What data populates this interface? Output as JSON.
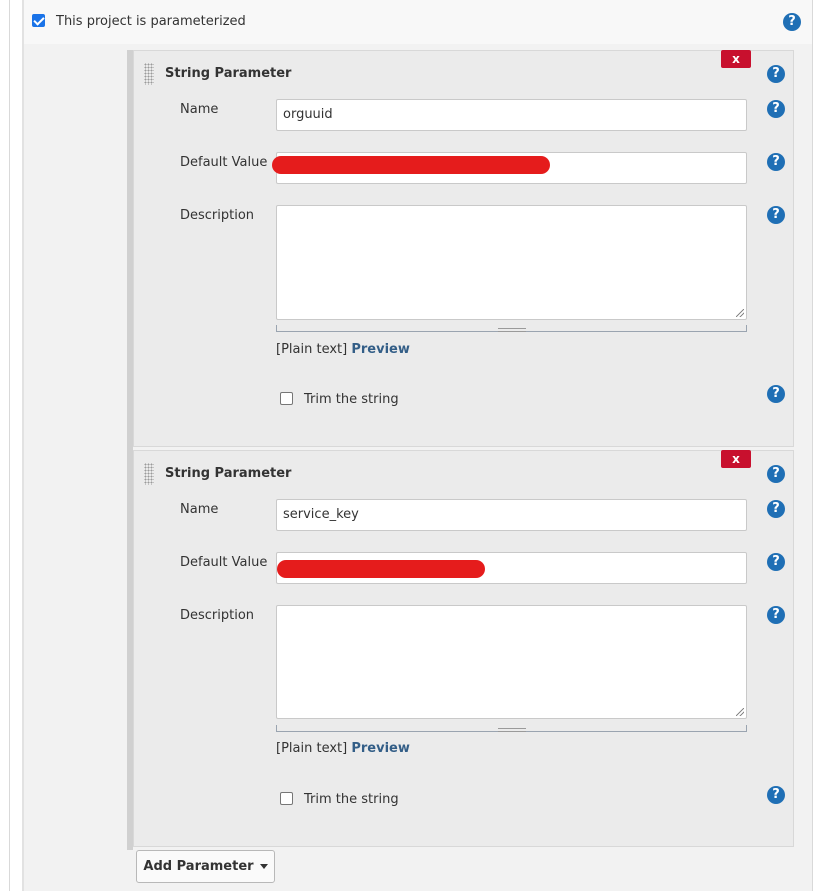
{
  "project": {
    "parameterized_label": "This project is parameterized",
    "parameterized_checked": true
  },
  "parameters": [
    {
      "title": "String Parameter",
      "delete_label": "x",
      "name_label": "Name",
      "name_value": "orguuid",
      "default_label": "Default Value",
      "description_label": "Description",
      "format_prefix": "[Plain text]",
      "preview_label": "Preview",
      "trim_label": "Trim the string",
      "trim_checked": false
    },
    {
      "title": "String Parameter",
      "delete_label": "x",
      "name_label": "Name",
      "name_value": "service_key",
      "default_label": "Default Value",
      "description_label": "Description",
      "format_prefix": "[Plain text]",
      "preview_label": "Preview",
      "trim_label": "Trim the string",
      "trim_checked": false
    }
  ],
  "add_parameter_label": "Add Parameter",
  "help_glyph": "?",
  "colors": {
    "help_icon": "#1f6fb5",
    "delete_button": "#c8102e",
    "redaction": "#e51c1c",
    "preview_link": "#335e87"
  }
}
